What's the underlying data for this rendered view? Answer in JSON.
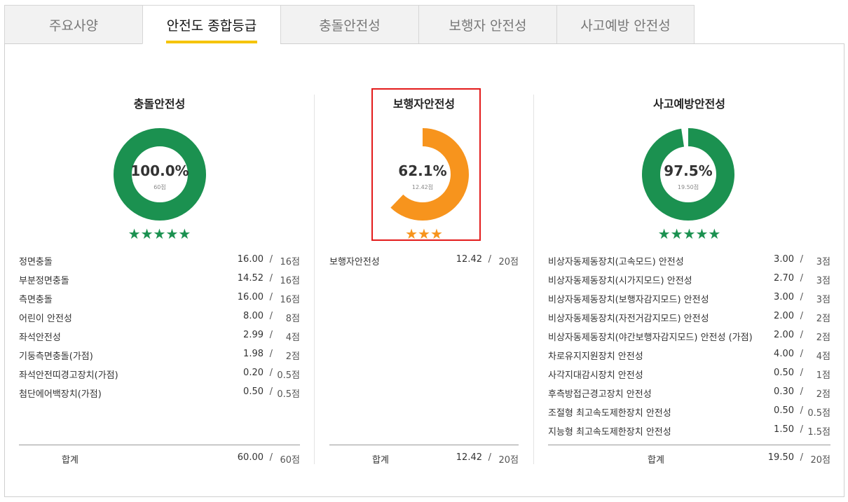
{
  "tabs": [
    {
      "label": "주요사양",
      "active": false
    },
    {
      "label": "안전도 종합등급",
      "active": true
    },
    {
      "label": "충돌안전성",
      "active": false
    },
    {
      "label": "보행자 안전성",
      "active": false
    },
    {
      "label": "사고예방 안전성",
      "active": false
    }
  ],
  "colors": {
    "green": "#1b9150",
    "orange": "#f7941d",
    "highlight": "#e31b1b",
    "tab_underline": "#f5c400"
  },
  "collision": {
    "title": "충돌안전성",
    "percent_text": "100.0%",
    "ratio": 1.0,
    "points_text": "60점",
    "stars": "★★★★★",
    "rows": [
      {
        "label": "정면충돌",
        "value": "16.00",
        "max": "16점"
      },
      {
        "label": "부분정면충돌",
        "value": "14.52",
        "max": "16점"
      },
      {
        "label": "측면충돌",
        "value": "16.00",
        "max": "16점"
      },
      {
        "label": "어린이 안전성",
        "value": "8.00",
        "max": "8점"
      },
      {
        "label": "좌석안전성",
        "value": "2.99",
        "max": "4점"
      },
      {
        "label": "기둥측면충돌(가점)",
        "value": "1.98",
        "max": "2점"
      },
      {
        "label": "좌석안전띠경고장치(가점)",
        "value": "0.20",
        "max": "0.5점"
      },
      {
        "label": "첨단에어백장치(가점)",
        "value": "0.50",
        "max": "0.5점"
      }
    ],
    "total": {
      "label": "합계",
      "value": "60.00",
      "max": "60점"
    }
  },
  "pedestrian": {
    "title": "보행자안전성",
    "percent_text": "62.1%",
    "ratio": 0.621,
    "points_text": "12.42점",
    "stars": "★★★",
    "rows": [
      {
        "label": "보행자안전성",
        "value": "12.42",
        "max": "20점"
      }
    ],
    "total": {
      "label": "합계",
      "value": "12.42",
      "max": "20점"
    }
  },
  "prevention": {
    "title": "사고예방안전성",
    "percent_text": "97.5%",
    "ratio": 0.975,
    "points_text": "19.50점",
    "stars": "★★★★★",
    "rows": [
      {
        "label": "비상자동제동장치(고속모드) 안전성",
        "value": "3.00",
        "max": "3점"
      },
      {
        "label": "비상자동제동장치(시가지모드) 안전성",
        "value": "2.70",
        "max": "3점"
      },
      {
        "label": "비상자동제동장치(보행자감지모드) 안전성",
        "value": "3.00",
        "max": "3점"
      },
      {
        "label": "비상자동제동장치(자전거감지모드) 안전성",
        "value": "2.00",
        "max": "2점"
      },
      {
        "label": "비상자동제동장치(야간보행자감지모드) 안전성 (가점)",
        "value": "2.00",
        "max": "2점"
      },
      {
        "label": "차로유지지원장치 안전성",
        "value": "4.00",
        "max": "4점"
      },
      {
        "label": "사각지대감시장치 안전성",
        "value": "0.50",
        "max": "1점"
      },
      {
        "label": "후측방접근경고장치 안전성",
        "value": "0.30",
        "max": "2점"
      },
      {
        "label": "조절형 최고속도제한장치 안전성",
        "value": "0.50",
        "max": "0.5점"
      },
      {
        "label": "지능형 최고속도제한장치 안전성",
        "value": "1.50",
        "max": "1.5점"
      }
    ],
    "total": {
      "label": "합계",
      "value": "19.50",
      "max": "20점"
    }
  },
  "separator": "/"
}
